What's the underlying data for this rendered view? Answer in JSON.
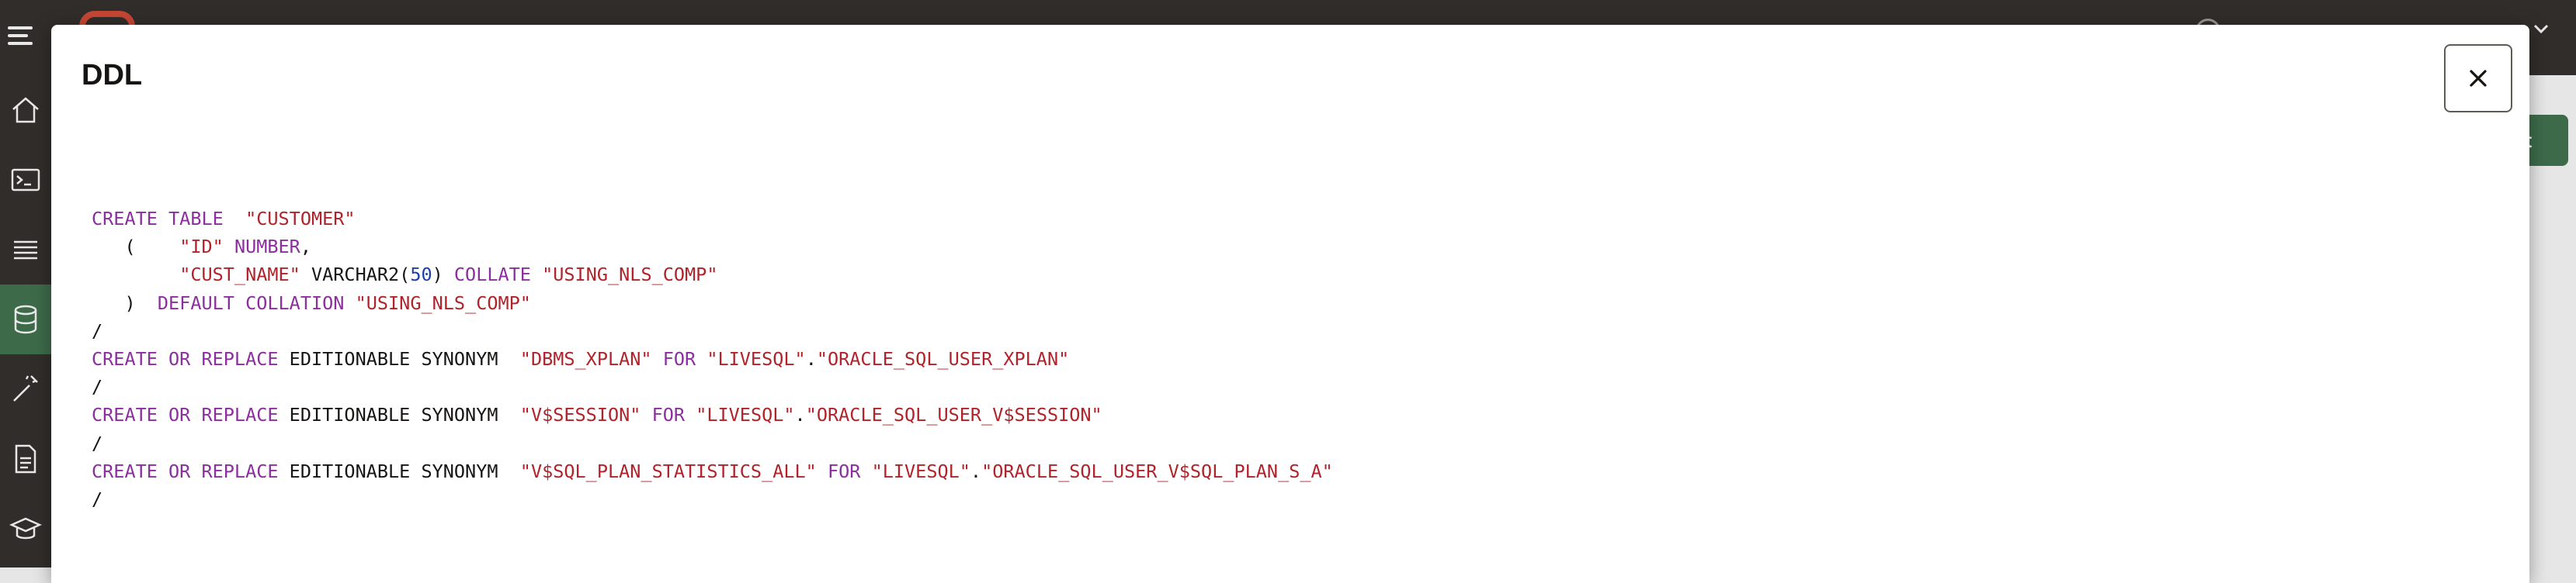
{
  "modal": {
    "title": "DDL",
    "close_icon": "close-icon"
  },
  "background": {
    "action_label": "ct",
    "sidebar_icons": [
      "home-icon",
      "terminal-icon",
      "list-icon",
      "database-icon",
      "magic-wand-icon",
      "document-icon",
      "graduation-cap-icon"
    ],
    "active_sidebar_index": 3,
    "brand_color": "#c74634",
    "accent_color": "#3d6b4a"
  },
  "colors": {
    "keyword": "#8b2e9e",
    "string": "#b0232a",
    "number": "#1f3fa6",
    "text": "#161513"
  },
  "ddl_lines": [
    [
      {
        "t": "kw",
        "v": "CREATE TABLE"
      },
      {
        "t": "txt",
        "v": "  "
      },
      {
        "t": "str",
        "v": "\"CUSTOMER\""
      }
    ],
    [
      {
        "t": "txt",
        "v": "   (    "
      },
      {
        "t": "str",
        "v": "\"ID\""
      },
      {
        "t": "txt",
        "v": " "
      },
      {
        "t": "kw",
        "v": "NUMBER"
      },
      {
        "t": "txt",
        "v": ","
      }
    ],
    [
      {
        "t": "txt",
        "v": "        "
      },
      {
        "t": "str",
        "v": "\"CUST_NAME\""
      },
      {
        "t": "txt",
        "v": " VARCHAR2("
      },
      {
        "t": "num",
        "v": "50"
      },
      {
        "t": "txt",
        "v": ") "
      },
      {
        "t": "kw",
        "v": "COLLATE"
      },
      {
        "t": "txt",
        "v": " "
      },
      {
        "t": "str",
        "v": "\"USING_NLS_COMP\""
      }
    ],
    [
      {
        "t": "txt",
        "v": "   )  "
      },
      {
        "t": "kw",
        "v": "DEFAULT COLLATION"
      },
      {
        "t": "txt",
        "v": " "
      },
      {
        "t": "str",
        "v": "\"USING_NLS_COMP\""
      }
    ],
    [
      {
        "t": "txt",
        "v": "/"
      }
    ],
    [
      {
        "t": "kw",
        "v": "CREATE OR REPLACE"
      },
      {
        "t": "txt",
        "v": " EDITIONABLE SYNONYM  "
      },
      {
        "t": "str",
        "v": "\"DBMS_XPLAN\""
      },
      {
        "t": "txt",
        "v": " "
      },
      {
        "t": "kw",
        "v": "FOR"
      },
      {
        "t": "txt",
        "v": " "
      },
      {
        "t": "str",
        "v": "\"LIVESQL\""
      },
      {
        "t": "txt",
        "v": "."
      },
      {
        "t": "str",
        "v": "\"ORACLE_SQL_USER_XPLAN\""
      }
    ],
    [
      {
        "t": "txt",
        "v": "/"
      }
    ],
    [
      {
        "t": "kw",
        "v": "CREATE OR REPLACE"
      },
      {
        "t": "txt",
        "v": " EDITIONABLE SYNONYM  "
      },
      {
        "t": "str",
        "v": "\"V$SESSION\""
      },
      {
        "t": "txt",
        "v": " "
      },
      {
        "t": "kw",
        "v": "FOR"
      },
      {
        "t": "txt",
        "v": " "
      },
      {
        "t": "str",
        "v": "\"LIVESQL\""
      },
      {
        "t": "txt",
        "v": "."
      },
      {
        "t": "str",
        "v": "\"ORACLE_SQL_USER_V$SESSION\""
      }
    ],
    [
      {
        "t": "txt",
        "v": "/"
      }
    ],
    [
      {
        "t": "kw",
        "v": "CREATE OR REPLACE"
      },
      {
        "t": "txt",
        "v": " EDITIONABLE SYNONYM  "
      },
      {
        "t": "str",
        "v": "\"V$SQL_PLAN_STATISTICS_ALL\""
      },
      {
        "t": "txt",
        "v": " "
      },
      {
        "t": "kw",
        "v": "FOR"
      },
      {
        "t": "txt",
        "v": " "
      },
      {
        "t": "str",
        "v": "\"LIVESQL\""
      },
      {
        "t": "txt",
        "v": "."
      },
      {
        "t": "str",
        "v": "\"ORACLE_SQL_USER_V$SQL_PLAN_S_A\""
      }
    ],
    [
      {
        "t": "txt",
        "v": "/"
      }
    ]
  ]
}
